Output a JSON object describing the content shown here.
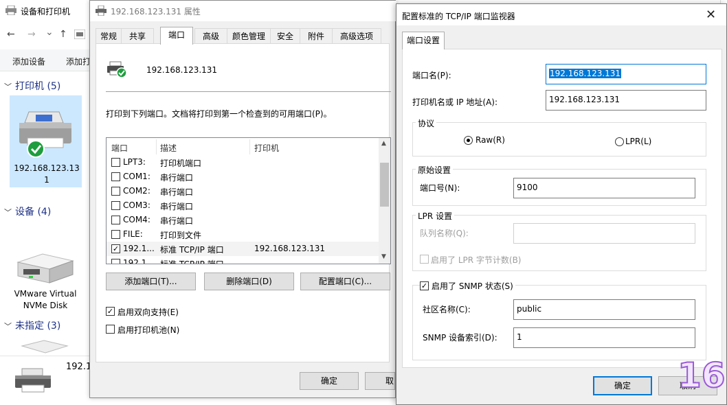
{
  "explorer": {
    "title": "设备和打印机",
    "nav": {
      "back": "←",
      "forward": "→",
      "recent": "⌄",
      "up": "↑"
    },
    "cmd": {
      "add_device": "添加设备",
      "add_printer": "添加打"
    },
    "groups": {
      "printers": "打印机 (5)",
      "devices": "设备 (4)",
      "unspecified": "未指定 (3)"
    },
    "printer_item_label": "192.168.123.131",
    "disk_label": "VMware Virtual NVMe Disk",
    "bottom_label": "192.1"
  },
  "props": {
    "title": "192.168.123.131 属性",
    "tabs": [
      "常规",
      "共享",
      "端口",
      "高级",
      "颜色管理",
      "安全",
      "附件",
      "高级选项"
    ],
    "printer_name": "192.168.123.131",
    "instruction": "打印到下列端口。文档将打印到第一个检查到的可用端口(P)。",
    "list_headers": {
      "port": "端口",
      "desc": "描述",
      "printer": "打印机"
    },
    "ports": [
      {
        "port": "LPT3:",
        "desc": "打印机端口",
        "printer": "",
        "checked": false
      },
      {
        "port": "COM1:",
        "desc": "串行端口",
        "printer": "",
        "checked": false
      },
      {
        "port": "COM2:",
        "desc": "串行端口",
        "printer": "",
        "checked": false
      },
      {
        "port": "COM3:",
        "desc": "串行端口",
        "printer": "",
        "checked": false
      },
      {
        "port": "COM4:",
        "desc": "串行端口",
        "printer": "",
        "checked": false
      },
      {
        "port": "FILE:",
        "desc": "打印到文件",
        "printer": "",
        "checked": false
      },
      {
        "port": "192.1...",
        "desc": "标准 TCP/IP 端口",
        "printer": "192.168.123.131",
        "checked": true
      },
      {
        "port": "192.1...",
        "desc": "标准 TCP/IP 端口",
        "printer": "",
        "checked": false
      }
    ],
    "btn_add": "添加端口(T)...",
    "btn_delete": "删除端口(D)",
    "btn_config": "配置端口(C)...",
    "bidi": "启用双向支持(E)",
    "pool": "启用打印机池(N)",
    "ok": "确定",
    "cancel": "取"
  },
  "tcp": {
    "title": "配置标准的 TCP/IP 端口监视器",
    "close": "✕",
    "tab": "端口设置",
    "port_name_label": "端口名(P):",
    "port_name": "192.168.123.131",
    "host_label": "打印机名或 IP 地址(A):",
    "host": "192.168.123.131",
    "protocol_title": "协议",
    "raw": "Raw(R)",
    "lpr": "LPR(L)",
    "raw_title": "原始设置",
    "port_num_label": "端口号(N):",
    "port_num": "9100",
    "lpr_title": "LPR 设置",
    "queue_label": "队列名称(Q):",
    "queue": "",
    "byte_count": "启用了 LPR 字节计数(B)",
    "snmp": "启用了 SNMP 状态(S)",
    "community_label": "社区名称(C):",
    "community": "public",
    "index_label": "SNMP 设备索引(D):",
    "index": "1",
    "ok": "确定",
    "cancel": "取消"
  },
  "watermark": "16"
}
